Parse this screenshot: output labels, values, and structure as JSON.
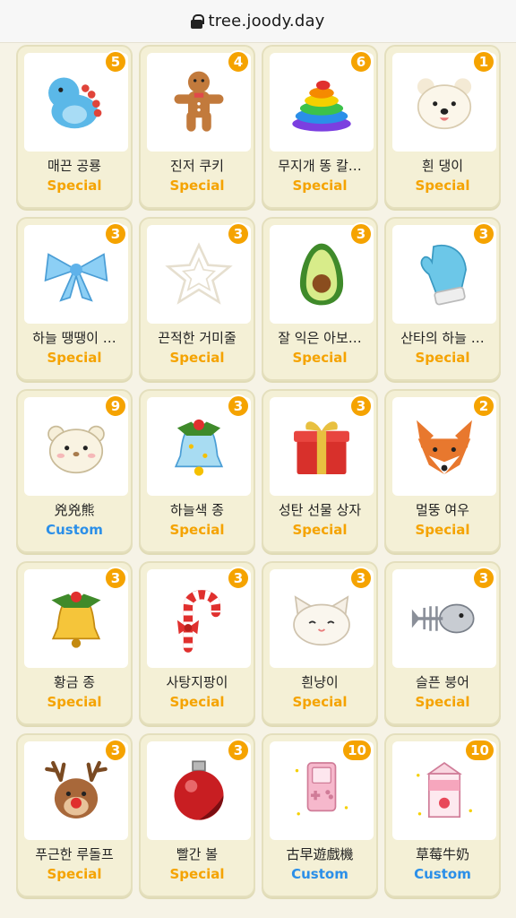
{
  "browser": {
    "url": "tree.joody.day"
  },
  "colors": {
    "special": "#f5a300",
    "custom": "#2b8fe8",
    "badge": "#f5a300"
  },
  "items": [
    {
      "name": "매끈 공룡",
      "tag": "Special",
      "count": "5",
      "icon": "blue-dinosaur-icon"
    },
    {
      "name": "진저 쿠키",
      "tag": "Special",
      "count": "4",
      "icon": "gingerbread-cookie-icon"
    },
    {
      "name": "무지개 똥 칼…",
      "tag": "Special",
      "count": "6",
      "icon": "rainbow-poop-icon"
    },
    {
      "name": "흰 댕이",
      "tag": "Special",
      "count": "1",
      "icon": "white-puppy-icon"
    },
    {
      "name": "하늘 땡땡이 …",
      "tag": "Special",
      "count": "3",
      "icon": "sky-blue-ribbon-icon"
    },
    {
      "name": "끈적한 거미줄",
      "tag": "Special",
      "count": "3",
      "icon": "spider-web-icon"
    },
    {
      "name": "잘 익은 아보…",
      "tag": "Special",
      "count": "3",
      "icon": "avocado-icon"
    },
    {
      "name": "산타의 하늘 …",
      "tag": "Special",
      "count": "3",
      "icon": "blue-mitten-icon"
    },
    {
      "name": "兇兇熊",
      "tag": "Custom",
      "count": "9",
      "icon": "bear-ornament-icon"
    },
    {
      "name": "하늘색 종",
      "tag": "Special",
      "count": "3",
      "icon": "sky-blue-bell-icon"
    },
    {
      "name": "성탄 선물 상자",
      "tag": "Special",
      "count": "3",
      "icon": "gift-box-icon"
    },
    {
      "name": "멀뚱 여우",
      "tag": "Special",
      "count": "2",
      "icon": "fox-icon"
    },
    {
      "name": "황금 종",
      "tag": "Special",
      "count": "3",
      "icon": "golden-bell-icon"
    },
    {
      "name": "사탕지팡이",
      "tag": "Special",
      "count": "3",
      "icon": "candy-cane-icon"
    },
    {
      "name": "흰냥이",
      "tag": "Special",
      "count": "3",
      "icon": "white-cat-icon"
    },
    {
      "name": "슬픈 붕어",
      "tag": "Special",
      "count": "3",
      "icon": "fish-bone-icon"
    },
    {
      "name": "푸근한 루돌프",
      "tag": "Special",
      "count": "3",
      "icon": "reindeer-icon"
    },
    {
      "name": "빨간 볼",
      "tag": "Special",
      "count": "3",
      "icon": "red-ornament-ball-icon"
    },
    {
      "name": "古早遊戲機",
      "tag": "Custom",
      "count": "10",
      "icon": "retro-game-console-icon"
    },
    {
      "name": "草莓牛奶",
      "tag": "Custom",
      "count": "10",
      "icon": "strawberry-milk-icon"
    }
  ]
}
